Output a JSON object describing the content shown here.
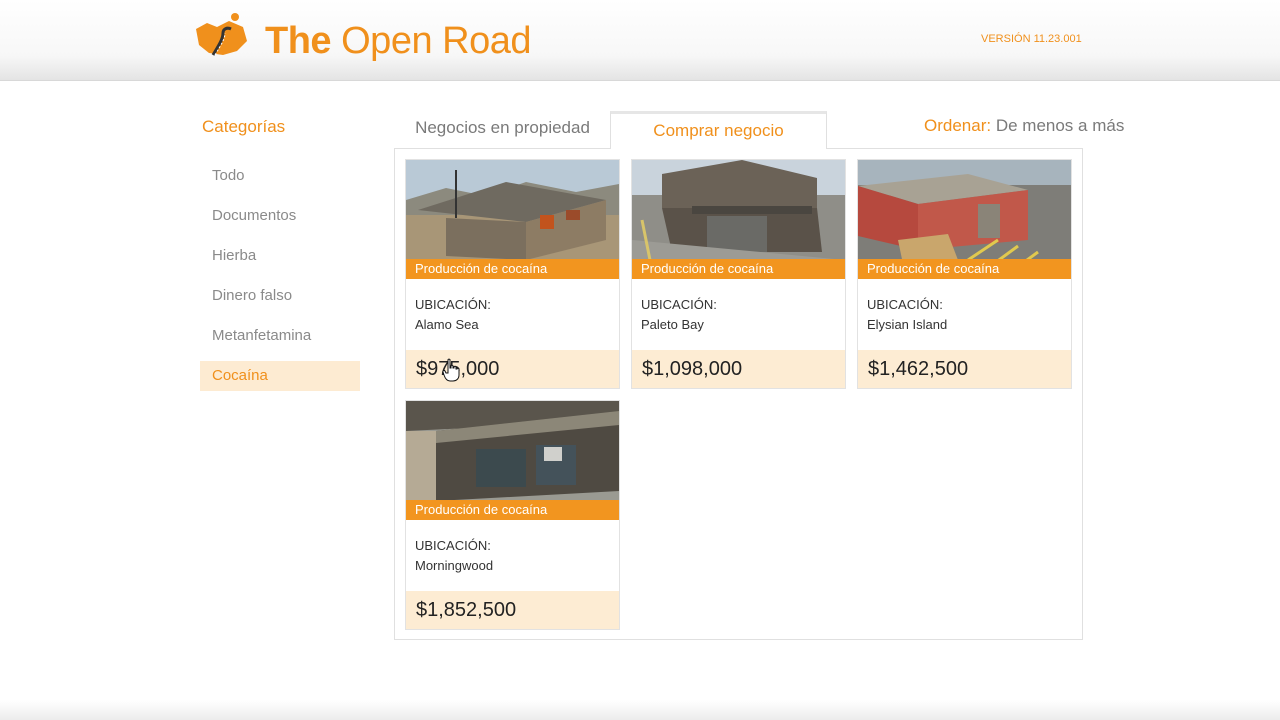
{
  "header": {
    "brand_part1": "The",
    "brand_part2": "Open Road",
    "version": "VERSIÓN 11.23.001",
    "logo_icon": "road-map-logo-icon",
    "accent_color": "#f0901c"
  },
  "sidebar": {
    "title": "Categorías",
    "items": [
      {
        "label": "Todo",
        "active": false
      },
      {
        "label": "Documentos",
        "active": false
      },
      {
        "label": "Hierba",
        "active": false
      },
      {
        "label": "Dinero falso",
        "active": false
      },
      {
        "label": "Metanfetamina",
        "active": false
      },
      {
        "label": "Cocaína",
        "active": true
      }
    ]
  },
  "tabs": {
    "owned": "Negocios en propiedad",
    "buy": "Comprar negocio",
    "active": "buy"
  },
  "sort": {
    "label": "Ordenar:",
    "value": "De menos a más"
  },
  "listings": [
    {
      "type": "Producción de cocaína",
      "location_label": "UBICACIÓN:",
      "location": "Alamo Sea",
      "price": "$975,000"
    },
    {
      "type": "Producción de cocaína",
      "location_label": "UBICACIÓN:",
      "location": "Paleto Bay",
      "price": "$1,098,000"
    },
    {
      "type": "Producción de cocaína",
      "location_label": "UBICACIÓN:",
      "location": "Elysian Island",
      "price": "$1,462,500"
    },
    {
      "type": "Producción de cocaína",
      "location_label": "UBICACIÓN:",
      "location": "Morningwood",
      "price": "$1,852,500"
    }
  ]
}
